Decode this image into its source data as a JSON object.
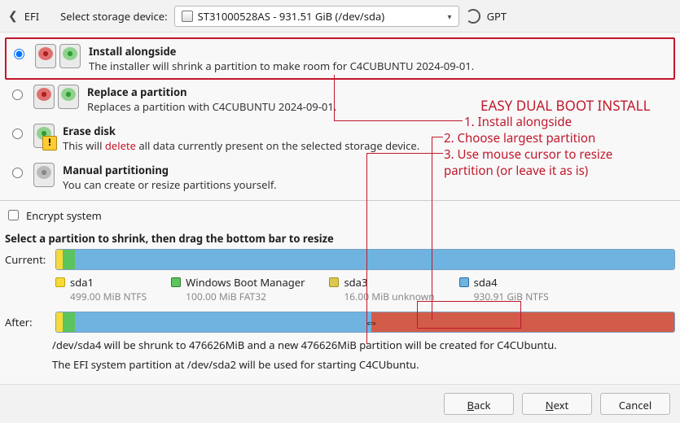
{
  "toolbar": {
    "efi_label": "EFI",
    "select_label": "Select storage device:",
    "device": "ST31000528AS - 931.51 GiB (/dev/sda)",
    "gpt_label": "GPT"
  },
  "options": [
    {
      "key": "alongside",
      "title": "Install alongside",
      "desc": "The installer will shrink a partition to make room for C4CUBUNTU 2024-09-01.",
      "checked": true
    },
    {
      "key": "replace",
      "title": "Replace a partition",
      "desc_pre": "Replaces a partition with C4CUBUNTU 2024-09-01.",
      "checked": false
    },
    {
      "key": "erase",
      "title": "Erase disk",
      "desc_pre": "This will ",
      "desc_danger": "delete",
      "desc_post": " all data currently present on the selected storage device.",
      "checked": false
    },
    {
      "key": "manual",
      "title": "Manual partitioning",
      "desc_pre": "You can create or resize partitions yourself.",
      "checked": false
    }
  ],
  "encrypt_label": "Encrypt system",
  "shrink_head": "Select a partition to shrink, then drag the bottom bar to resize",
  "labels": {
    "current": "Current:",
    "after": "After:"
  },
  "legend": [
    {
      "name": "sda1",
      "sub": "499.00 MiB  NTFS",
      "cls": "y"
    },
    {
      "name": "Windows Boot Manager",
      "sub": "100.00 MiB  FAT32",
      "cls": "g"
    },
    {
      "name": "sda3",
      "sub": "16.00 MiB  unknown",
      "cls": "y2"
    },
    {
      "name": "sda4",
      "sub": "930.91 GiB  NTFS",
      "cls": "b"
    }
  ],
  "msg1": "/dev/sda4 will be shrunk to 476626MiB and a new 476626MiB partition will be created for C4CUbuntu.",
  "msg2": "The EFI system partition at /dev/sda2 will be used for starting C4CUbuntu.",
  "buttons": {
    "back": "Back",
    "next": "Next",
    "cancel": "Cancel"
  },
  "anno": {
    "title": "EASY DUAL BOOT INSTALL",
    "l1": "1. Install alongside",
    "l2": "2. Choose largest partition",
    "l3": "3. Use mouse cursor to resize",
    "l3b": "    partition (or leave it as is)"
  }
}
